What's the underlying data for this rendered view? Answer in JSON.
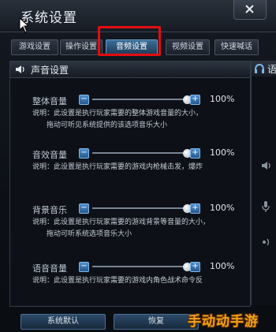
{
  "window": {
    "title": "系统设置"
  },
  "tabs": [
    {
      "label": "游戏设置",
      "active": false
    },
    {
      "label": "操作设置",
      "active": false
    },
    {
      "label": "音频设置",
      "active": true
    },
    {
      "label": "视频设置",
      "active": false
    },
    {
      "label": "快速喊话",
      "active": false
    }
  ],
  "panel": {
    "title": "声音设置"
  },
  "settings": [
    {
      "label": "整体音量",
      "value_text": "100%",
      "level": 1.0,
      "desc1": "说明：此设置是执行玩家需要的整体游戏音量的大小，",
      "desc2": "拖动可听见系统提供的该选项音乐大小"
    },
    {
      "label": "音效音量",
      "value_text": "100%",
      "level": 1.0,
      "desc1": "说明：此设置是执行玩家需要的游戏内枪械击发，爆炸",
      "desc2": ""
    },
    {
      "label": "背景音乐",
      "value_text": "100%",
      "level": 1.0,
      "desc1": "说明：此设置是执行玩家需要的游戏背景等音量的大小，",
      "desc2": "拖动可听系统选项音乐大小"
    },
    {
      "label": "语音音量",
      "value_text": "100%",
      "level": 1.0,
      "desc1": "说明：此设置是执行玩家需要的游戏内角色战术命令反",
      "desc2": ""
    }
  ],
  "right_panel": {
    "title": "语"
  },
  "buttons": {
    "default": "系统默认",
    "restore": "恢复"
  },
  "watermark": "手动动手游",
  "colors": {
    "highlight": "#e30d12",
    "accent": "#4d8fd0",
    "watermark": "#f2a21a"
  }
}
